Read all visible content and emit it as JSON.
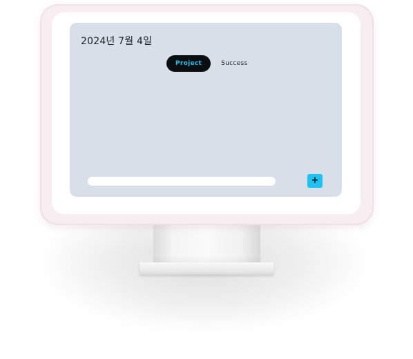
{
  "screen": {
    "date_title": "2024년 7월 4일",
    "tabs": [
      {
        "label": "Project",
        "active": true
      },
      {
        "label": "Success",
        "active": false
      }
    ],
    "input": {
      "value": "",
      "placeholder": ""
    },
    "add_button_label": "+"
  },
  "colors": {
    "screen_bg": "#d7e0e8",
    "bezel": "#f7eef1",
    "accent": "#1ec1ef",
    "active_tab_bg": "#0b0e10"
  }
}
